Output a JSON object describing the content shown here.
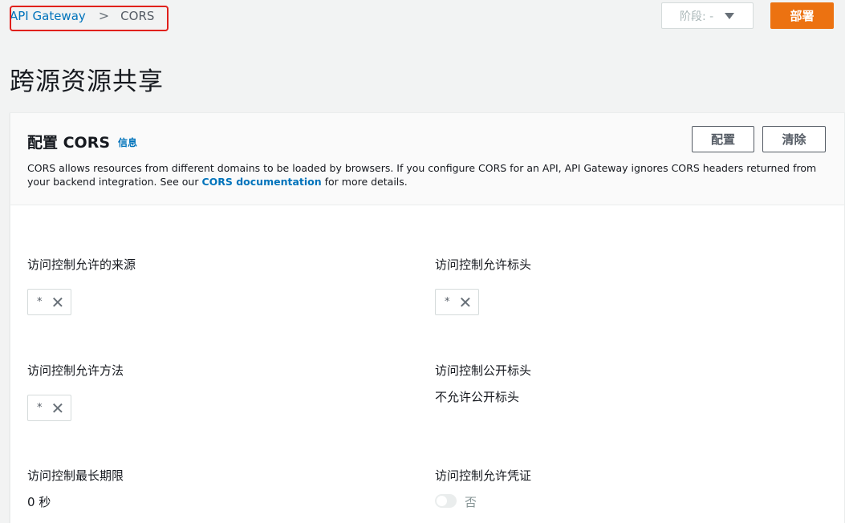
{
  "breadcrumb": {
    "root": "API Gateway",
    "separator": ">",
    "current": "CORS"
  },
  "toolbar": {
    "stage_label": "阶段: -",
    "deploy_label": "部署"
  },
  "page": {
    "title": "跨源资源共享"
  },
  "panel": {
    "title": "配置 CORS",
    "info_link": "信息",
    "config_button": "配置",
    "clear_button": "清除",
    "description_prefix": "CORS allows resources from different domains to be loaded by browsers. If you configure CORS for an API, API Gateway ignores CORS headers returned from your backend integration. See our ",
    "description_link": "CORS documentation",
    "description_suffix": " for more details."
  },
  "fields": {
    "allow_origin": {
      "label": "访问控制允许的来源",
      "token": "*"
    },
    "allow_headers": {
      "label": "访问控制允许标头",
      "token": "*"
    },
    "allow_methods": {
      "label": "访问控制允许方法",
      "token": "*"
    },
    "expose_headers": {
      "label": "访问控制公开标头",
      "value": "不允许公开标头"
    },
    "max_age": {
      "label": "访问控制最长期限",
      "value": "0 秒"
    },
    "allow_credentials": {
      "label": "访问控制允许凭证",
      "toggle_label": "否",
      "enabled": false
    }
  },
  "icons": {
    "remove": "close-icon",
    "dropdown": "caret-down-icon"
  },
  "colors": {
    "accent": "#ec7211",
    "link": "#0073bb",
    "highlight": "#e0201b"
  }
}
